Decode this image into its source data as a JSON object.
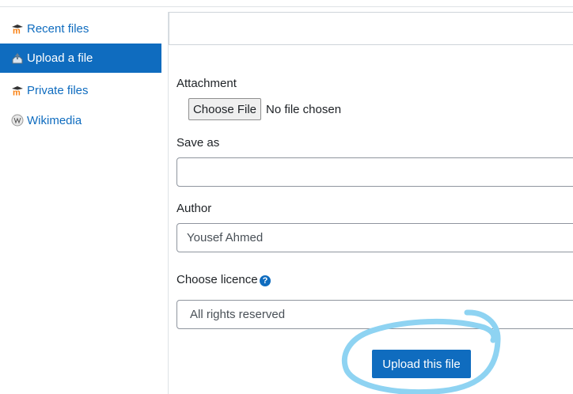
{
  "sidebar": {
    "items": [
      {
        "label": "Recent files",
        "icon": "moodle-icon",
        "active": false
      },
      {
        "label": "Upload a file",
        "icon": "upload-icon",
        "active": true
      },
      {
        "label": "Private files",
        "icon": "moodle-icon",
        "active": false
      },
      {
        "label": "Wikimedia",
        "icon": "wikipedia-icon",
        "active": false
      }
    ]
  },
  "form": {
    "attachment_label": "Attachment",
    "choose_file_label": "Choose File",
    "no_file_text": "No file chosen",
    "save_as_label": "Save as",
    "save_as_value": "",
    "author_label": "Author",
    "author_value": "Yousef Ahmed",
    "licence_label": "Choose licence",
    "licence_help": "?",
    "licence_value": "All rights reserved",
    "upload_label": "Upload this file"
  },
  "colors": {
    "accent": "#0f6cbf",
    "annotation": "#8ed3f2"
  }
}
